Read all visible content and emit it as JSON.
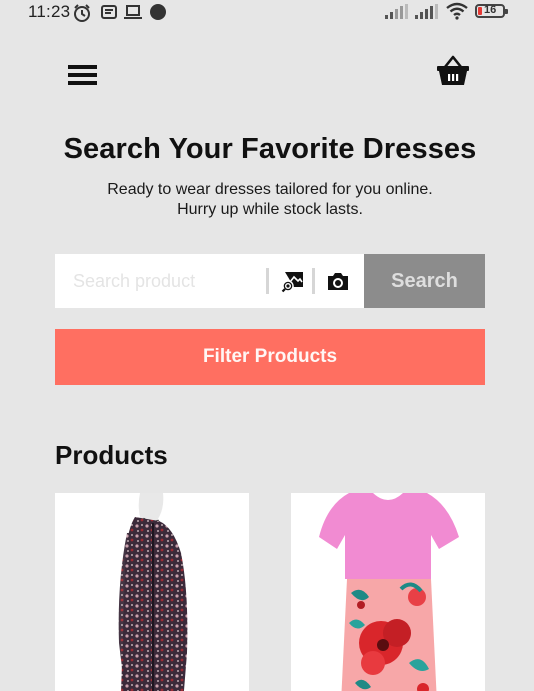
{
  "status_bar": {
    "time": "11:23",
    "battery_level": "16",
    "icons": [
      "alarm-icon",
      "notification-icon",
      "laptop-icon",
      "dot-icon",
      "signal-icon",
      "signal-icon",
      "wifi-icon",
      "battery-icon"
    ]
  },
  "header": {
    "menu_icon": "hamburger-menu-icon",
    "cart_icon": "shopping-basket-icon"
  },
  "hero": {
    "title": "Search Your Favorite Dresses",
    "subtitle_line1": "Ready to wear dresses tailored for you online.",
    "subtitle_line2": "Hurry up while stock lasts."
  },
  "search": {
    "placeholder": "Search product",
    "value": "",
    "image_search_icon": "image-search-icon",
    "camera_icon": "camera-icon",
    "button_label": "Search"
  },
  "filter": {
    "button_label": "Filter Products"
  },
  "products": {
    "section_title": "Products",
    "items": [
      {
        "image": "floral-print-cardigan-image"
      },
      {
        "image": "pink-floral-dress-image"
      }
    ]
  },
  "colors": {
    "background": "#e6e6e6",
    "accent": "#ff6f61",
    "search_button": "#8c8c8c",
    "battery_low": "#e53935"
  }
}
